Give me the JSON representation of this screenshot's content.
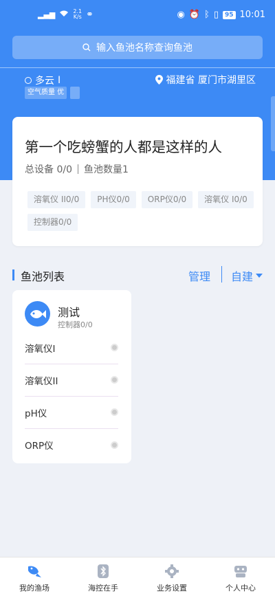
{
  "status_bar": {
    "signal": "⁴ᴳ",
    "net_speed": "2.1",
    "net_unit": "K/s",
    "battery": "95",
    "time": "10:01"
  },
  "search": {
    "placeholder": "输入鱼池名称查询鱼池"
  },
  "weather": {
    "condition": "多云",
    "air_quality": "空气质量 优"
  },
  "location": {
    "text": "福建省 厦门市湖里区"
  },
  "card": {
    "title": "第一个吃螃蟹的人都是这样的人",
    "total_devices": "总设备 0/0",
    "pond_count": "鱼池数量1",
    "chips": [
      "溶氧仪 II0/0",
      "PH仪0/0",
      "ORP仪0/0",
      "溶氧仪 I0/0",
      "控制器0/0"
    ]
  },
  "pond_list": {
    "title": "鱼池列表",
    "manage": "管理",
    "self_build": "自建"
  },
  "pond": {
    "name": "测试",
    "controller": "控制器0/0",
    "devices": [
      "溶氧仪I",
      "溶氧仪II",
      "pH仪",
      "ORP仪"
    ]
  },
  "tabs": [
    {
      "label": "我的渔场",
      "icon": "fish-icon",
      "active": true
    },
    {
      "label": "海控在手",
      "icon": "bluetooth-icon",
      "active": false
    },
    {
      "label": "业务设置",
      "icon": "gear-icon",
      "active": false
    },
    {
      "label": "个人中心",
      "icon": "robot-icon",
      "active": false
    }
  ],
  "colors": {
    "primary": "#3d8af5",
    "background": "#eef1f7"
  }
}
